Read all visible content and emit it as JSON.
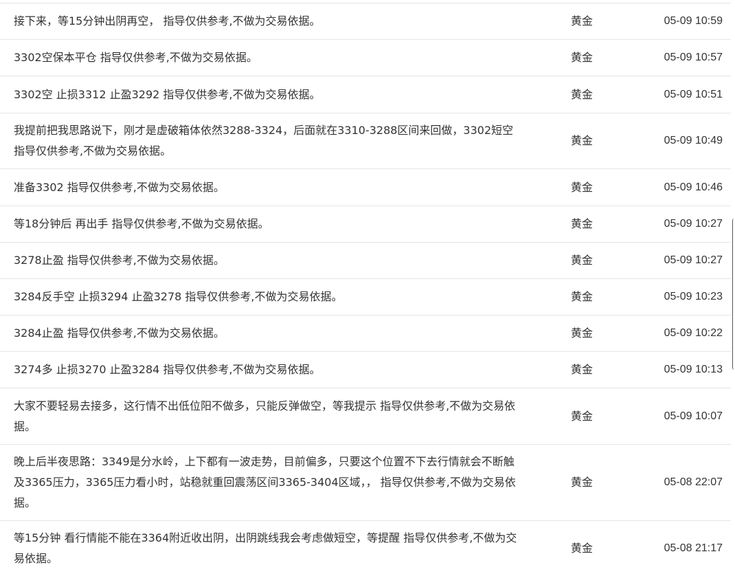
{
  "messages": [
    {
      "text": "接下来，等15分钟出阴再空， 指导仅供参考,不做为交易依据。",
      "category": "黄金",
      "time": "05-09 10:59"
    },
    {
      "text": "3302空保本平仓 指导仅供参考,不做为交易依据。",
      "category": "黄金",
      "time": "05-09 10:57"
    },
    {
      "text": "3302空 止损3312 止盈3292 指导仅供参考,不做为交易依据。",
      "category": "黄金",
      "time": "05-09 10:51"
    },
    {
      "text": "我提前把我思路说下，刚才是虚破箱体依然3288-3324，后面就在3310-3288区间来回做，3302短空 指导仅供参考,不做为交易依据。",
      "category": "黄金",
      "time": "05-09 10:49"
    },
    {
      "text": "准备3302 指导仅供参考,不做为交易依据。",
      "category": "黄金",
      "time": "05-09 10:46"
    },
    {
      "text": "等18分钟后 再出手 指导仅供参考,不做为交易依据。",
      "category": "黄金",
      "time": "05-09 10:27"
    },
    {
      "text": "3278止盈 指导仅供参考,不做为交易依据。",
      "category": "黄金",
      "time": "05-09 10:27"
    },
    {
      "text": "3284反手空 止损3294 止盈3278 指导仅供参考,不做为交易依据。",
      "category": "黄金",
      "time": "05-09 10:23"
    },
    {
      "text": "3284止盈 指导仅供参考,不做为交易依据。",
      "category": "黄金",
      "time": "05-09 10:22"
    },
    {
      "text": "3274多 止损3270 止盈3284 指导仅供参考,不做为交易依据。",
      "category": "黄金",
      "time": "05-09 10:13"
    },
    {
      "text": "大家不要轻易去接多，这行情不出低位阳不做多，只能反弹做空，等我提示 指导仅供参考,不做为交易依据。",
      "category": "黄金",
      "time": "05-09 10:07"
    },
    {
      "text": "晚上后半夜思路：3349是分水岭，上下都有一波走势，目前偏多，只要这个位置不下去行情就会不断触及3365压力，3365压力看小时，站稳就重回震荡区间3365-3404区域，， 指导仅供参考,不做为交易依据。",
      "category": "黄金",
      "time": "05-08 22:07"
    },
    {
      "text": "等15分钟 看行情能不能在3364附近收出阴，出阴跳线我会考虑做短空，等提醒 指导仅供参考,不做为交易依据。",
      "category": "黄金",
      "time": "05-08 21:17"
    }
  ]
}
